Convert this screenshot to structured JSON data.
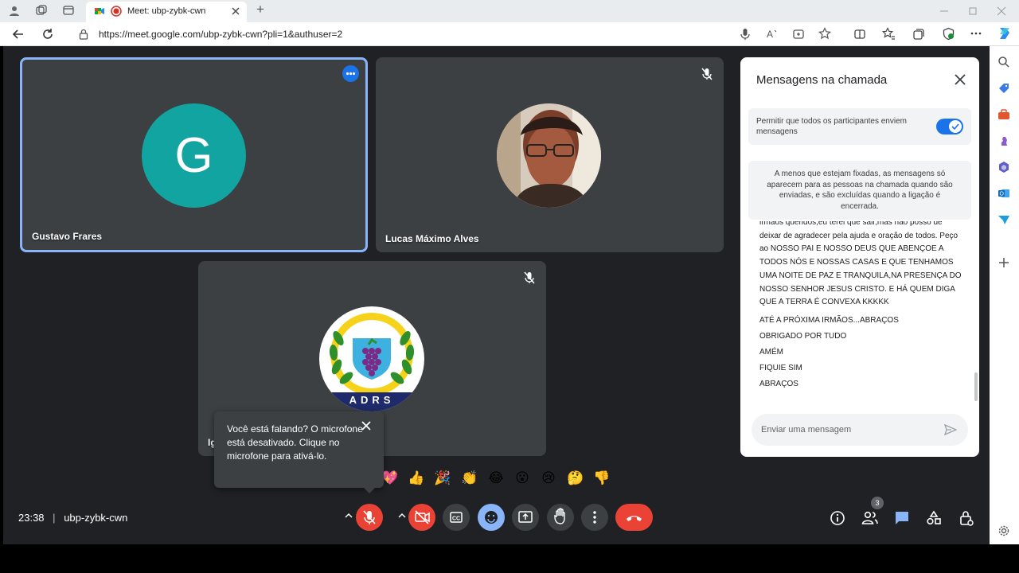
{
  "browser": {
    "tab_title": "Meet: ubp-zybk-cwn",
    "url": "https://meet.google.com/ubp-zybk-cwn?pli=1&authuser=2",
    "new_tab_symbol": "+"
  },
  "participants": [
    {
      "name": "Gustavo Frares",
      "initial": "G",
      "avatar_color": "#12a4a0",
      "active": true
    },
    {
      "name": "Lucas Máximo Alves",
      "muted": true
    },
    {
      "name": "Ig",
      "muted": true,
      "logo_text": "ADRS"
    }
  ],
  "tooltip": {
    "text": "Você está falando? O microfone está desativado. Clique no microfone para ativá-lo."
  },
  "reactions": [
    "💖",
    "👍",
    "🎉",
    "👏",
    "😂",
    "😮",
    "😢",
    "🤔",
    "👎"
  ],
  "chat": {
    "title": "Mensagens na chamada",
    "toggle_label": "Permitir que todos os participantes enviem mensagens",
    "toggle_on": true,
    "info": "A menos que estejam fixadas, as mensagens só aparecem para as pessoas na chamada quando são enviadas, e são excluídas quando a ligação é encerrada.",
    "message_block": "irmãos queridos,eu terei que sair,mas não posso de deixar de agradecer pela ajuda e oração de todos. Peço ao NOSSO PAI E NOSSO DEUS QUE ABENÇOE A TODOS NÓS E NOSSAS CASAS E QUE TENHAMOS UMA NOITE DE PAZ E TRANQUILA,NA PRESENÇA DO NOSSO SENHOR JESUS CRISTO. E HÁ QUEM DIGA QUE A TERRA É CONVEXA KKKKK",
    "messages": [
      "ATÉ A PRÓXIMA IRMÃOS...ABRAÇOS",
      "OBRIGADO POR TUDO",
      "AMÉM",
      "FIQUIE SIM",
      "ABRAÇOS"
    ],
    "input_placeholder": "Enviar uma mensagem"
  },
  "toolbar": {
    "time": "23:38",
    "separator": "|",
    "meeting_code": "ubp-zybk-cwn",
    "participant_count": "3"
  },
  "colors": {
    "stage_bg": "#202124",
    "tile_bg": "#3c4043",
    "danger": "#ea4335",
    "accent": "#8ab4f8",
    "toggle": "#1a73e8"
  }
}
